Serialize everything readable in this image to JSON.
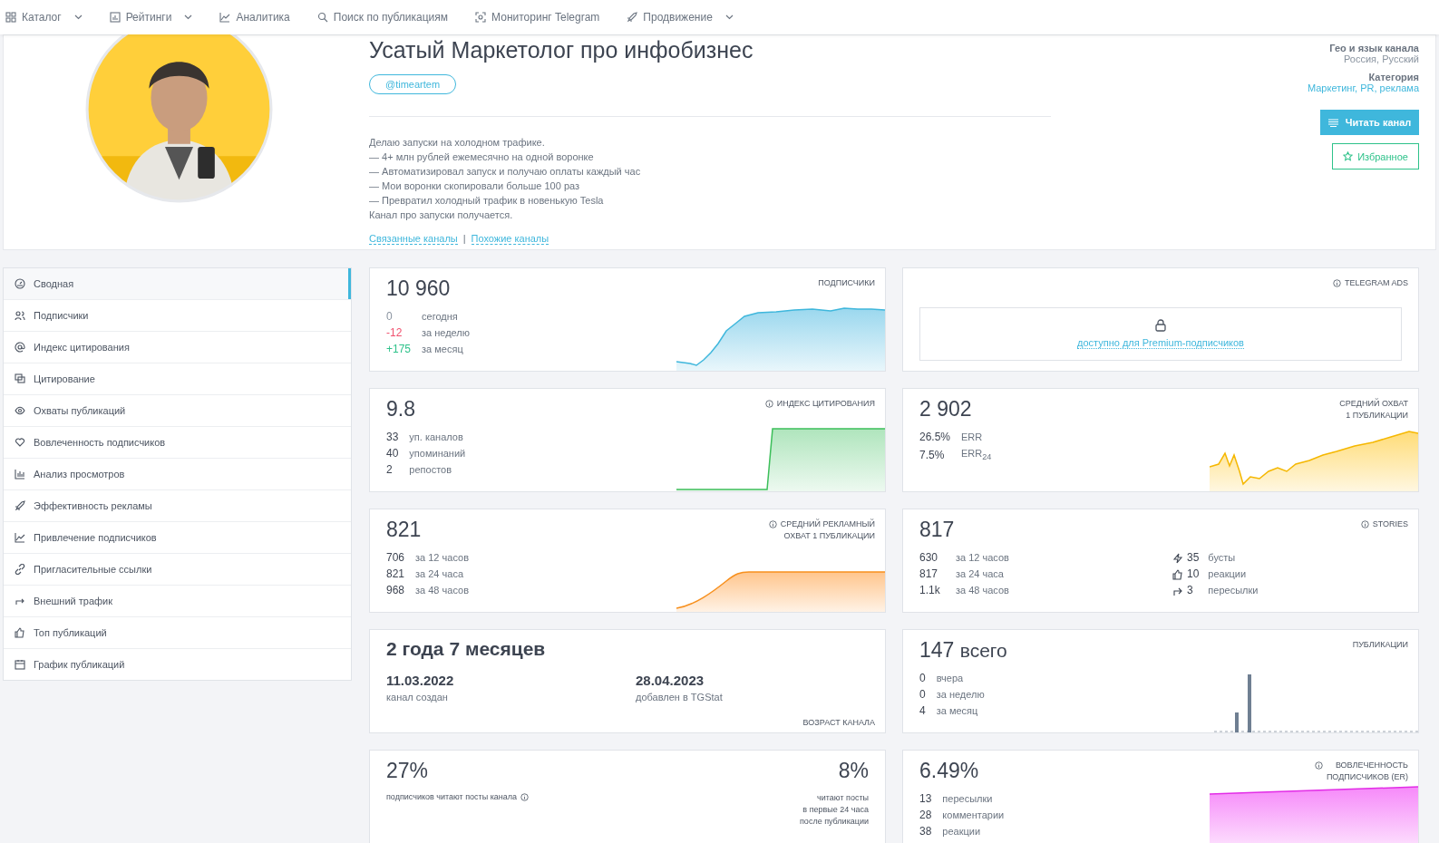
{
  "nav": [
    {
      "label": "Каталог",
      "dropdown": true
    },
    {
      "label": "Рейтинги",
      "dropdown": true
    },
    {
      "label": "Аналитика",
      "dropdown": false
    },
    {
      "label": "Поиск по публикациям",
      "dropdown": false
    },
    {
      "label": "Мониторинг Telegram",
      "dropdown": false
    },
    {
      "label": "Продвижение",
      "dropdown": true
    }
  ],
  "header": {
    "title": "Усатый Маркетолог про инфобизнес",
    "handle": "@timeartem",
    "description": [
      "Делаю запуски на холодном трафике.",
      "— 4+ млн рублей ежемесячно на одной воронке",
      "— Автоматизировал запуск и получаю оплаты каждый час",
      "— Мои воронки скопировали больше 100 раз",
      "— Превратил холодный трафик в новенькую Tesla",
      "Канал про запуски получается."
    ],
    "links": [
      "Связанные каналы",
      "Похожие каналы"
    ],
    "separator": "|",
    "geo_label": "Гео и язык канала",
    "geo_value": "Россия, Русский",
    "category_label": "Категория",
    "category_value": "Маркетинг, PR, реклама",
    "read_button": "Читать канал",
    "favorite_button": "Избранное"
  },
  "sidebar": {
    "items": [
      {
        "label": "Сводная",
        "selected": true
      },
      {
        "label": "Подписчики",
        "selected": false
      },
      {
        "label": "Индекс цитирования",
        "selected": false
      },
      {
        "label": "Цитирование",
        "selected": false
      },
      {
        "label": "Охваты публикаций",
        "selected": false
      },
      {
        "label": "Вовлеченность подписчиков",
        "selected": false
      },
      {
        "label": "Анализ просмотров",
        "selected": false
      },
      {
        "label": "Эффективность рекламы",
        "selected": false
      },
      {
        "label": "Привлечение подписчиков",
        "selected": false
      },
      {
        "label": "Пригласительные ссылки",
        "selected": false
      },
      {
        "label": "Внешний трафик",
        "selected": false
      },
      {
        "label": "Топ публикаций",
        "selected": false
      },
      {
        "label": "График публикаций",
        "selected": false
      }
    ]
  },
  "cards": [
    {
      "kind": "stat",
      "value": "10 960",
      "title": [
        "ПОДПИСЧИКИ"
      ],
      "info": false,
      "rows": [
        {
          "value": "0",
          "label": "сегодня",
          "color": "#8a94a0"
        },
        {
          "value": "-12",
          "label": "за неделю",
          "color": "#f0506e"
        },
        {
          "value": "+175",
          "label": "за месяц",
          "color": "#2ec28a"
        }
      ]
    },
    {
      "kind": "locked",
      "title": [
        "TELEGRAM ADS"
      ],
      "info": true,
      "link": "доступно для Premium-подписчиков"
    },
    {
      "kind": "stat",
      "value": "9.8",
      "title": [
        "ИНДЕКС ЦИТИРОВАНИЯ"
      ],
      "info": true,
      "rows": [
        {
          "value": "33",
          "label": "уп. каналов"
        },
        {
          "value": "40",
          "label": "упоминаний"
        },
        {
          "value": "2",
          "label": "репостов"
        }
      ]
    },
    {
      "kind": "stat",
      "value": "2 902",
      "title": [
        "СРЕДНИЙ ОХВАТ",
        "1 ПУБЛИКАЦИИ"
      ],
      "info": false,
      "rows": [
        {
          "value": "26.5%",
          "label": "ERR"
        },
        {
          "value": "7.5%",
          "label": "ERR$_{24}$"
        }
      ]
    },
    {
      "kind": "stat",
      "value": "821",
      "title": [
        "СРЕДНИЙ РЕКЛАМНЫЙ",
        "ОХВАТ 1 ПУБЛИКАЦИИ"
      ],
      "info": true,
      "rows": [
        {
          "value": "706",
          "label": "за 12 часов"
        },
        {
          "value": "821",
          "label": "за 24 часа"
        },
        {
          "value": "968",
          "label": "за 48 часов"
        }
      ]
    },
    {
      "kind": "stat",
      "value": "817",
      "title": [
        "STORIES"
      ],
      "info": true,
      "rows": [
        {
          "value": "630",
          "label": "за 12 часов"
        },
        {
          "value": "817",
          "label": "за 24 часа"
        },
        {
          "value": "1.1k",
          "label": "за 48 часов"
        }
      ],
      "side_rows": [
        {
          "value": "35",
          "label": "бусты"
        },
        {
          "value": "10",
          "label": "реакции"
        },
        {
          "value": "3",
          "label": "пересылки"
        }
      ]
    },
    {
      "kind": "age",
      "value": "2 года 7 месяцев",
      "dates": [
        {
          "value": "11.03.2022",
          "label": "канал создан"
        },
        {
          "value": "28.04.2023",
          "label": "добавлен в TGStat"
        }
      ],
      "footer": "ВОЗРАСТ КАНАЛА"
    },
    {
      "kind": "stat",
      "value": "147",
      "unit": "всего",
      "title": [
        "ПУБЛИКАЦИИ"
      ],
      "info": false,
      "rows": [
        {
          "value": "0",
          "label": "вчера"
        },
        {
          "value": "0",
          "label": "за неделю"
        },
        {
          "value": "4",
          "label": "за месяц"
        }
      ]
    },
    {
      "kind": "reading",
      "left_value": "27%",
      "left_caption": "подписчиков читают посты канала",
      "right_value": "8%",
      "right_caption": [
        "читают посты",
        "в первые 24 часа",
        "после публикации"
      ]
    },
    {
      "kind": "stat",
      "value": "6.49%",
      "title": [
        "ВОВЛЕЧЕННОСТЬ",
        "ПОДПИСЧИКОВ (ER)"
      ],
      "info": true,
      "rows": [
        {
          "value": "13",
          "label": "пересылки"
        },
        {
          "value": "28",
          "label": "комментарии"
        },
        {
          "value": "38",
          "label": "реакции"
        }
      ]
    }
  ]
}
